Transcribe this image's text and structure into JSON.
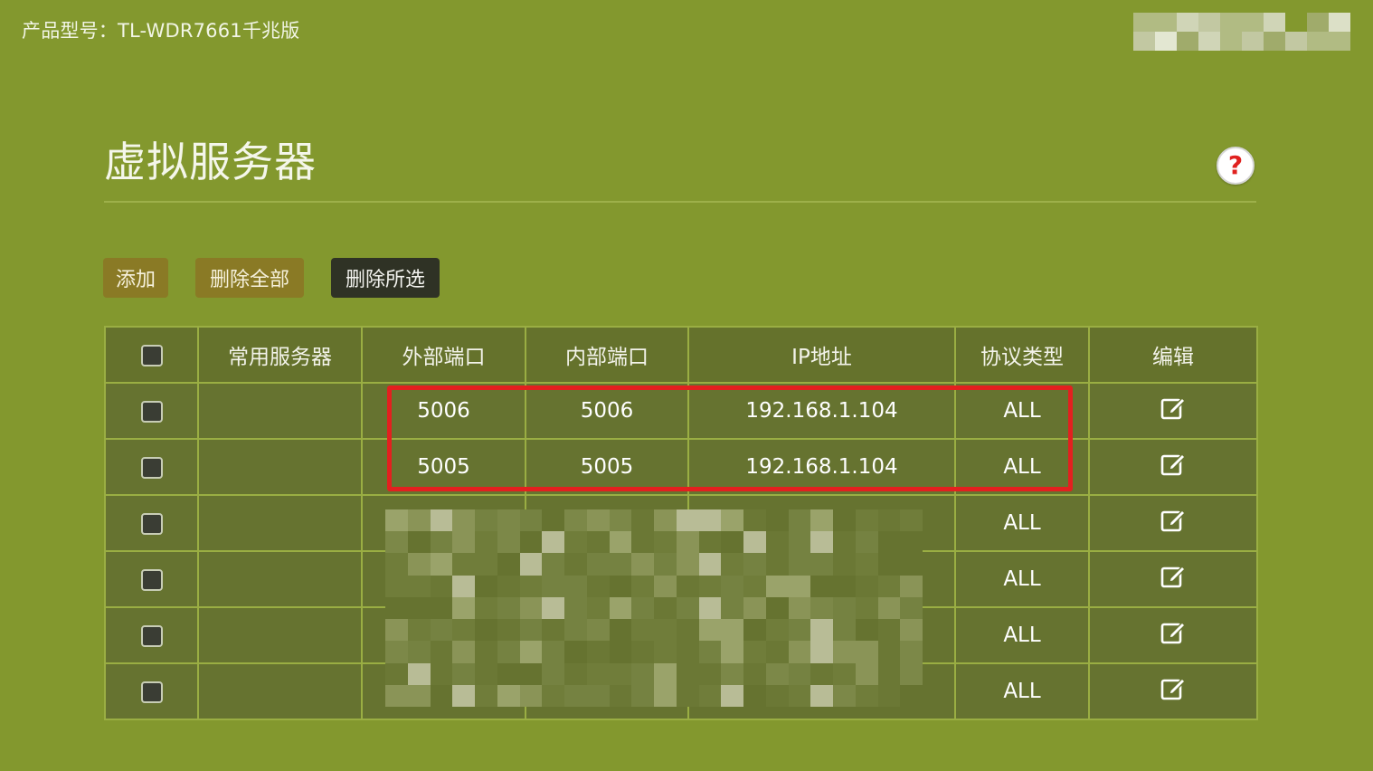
{
  "header": {
    "product_model": "产品型号：TL-WDR7661千兆版"
  },
  "page": {
    "title": "虚拟服务器",
    "help_icon": "help-icon"
  },
  "toolbar": {
    "add_label": "添加",
    "delete_all_label": "删除全部",
    "delete_selected_label": "删除所选"
  },
  "table": {
    "headers": {
      "select_all": "",
      "common_server": "常用服务器",
      "external_port": "外部端口",
      "internal_port": "内部端口",
      "ip_address": "IP地址",
      "protocol": "协议类型",
      "edit": "编辑"
    },
    "rows": [
      {
        "common_server": "",
        "external_port": "5006",
        "internal_port": "5006",
        "ip": "192.168.1.104",
        "protocol": "ALL"
      },
      {
        "common_server": "",
        "external_port": "5005",
        "internal_port": "5005",
        "ip": "192.168.1.104",
        "protocol": "ALL"
      },
      {
        "common_server": "",
        "external_port": "",
        "internal_port": "",
        "ip": "",
        "protocol": "ALL"
      },
      {
        "common_server": "",
        "external_port": "",
        "internal_port": "",
        "ip": "",
        "protocol": "ALL"
      },
      {
        "common_server": "",
        "external_port": "",
        "internal_port": "",
        "ip": "",
        "protocol": "ALL"
      },
      {
        "common_server": "",
        "external_port": "",
        "internal_port": "",
        "ip": "",
        "protocol": "ALL"
      }
    ]
  },
  "colors": {
    "background": "#83982e",
    "table_row": "#667330",
    "button_primary": "#8a7a25",
    "button_dark": "#2f3225",
    "highlight": "#e3201f"
  }
}
